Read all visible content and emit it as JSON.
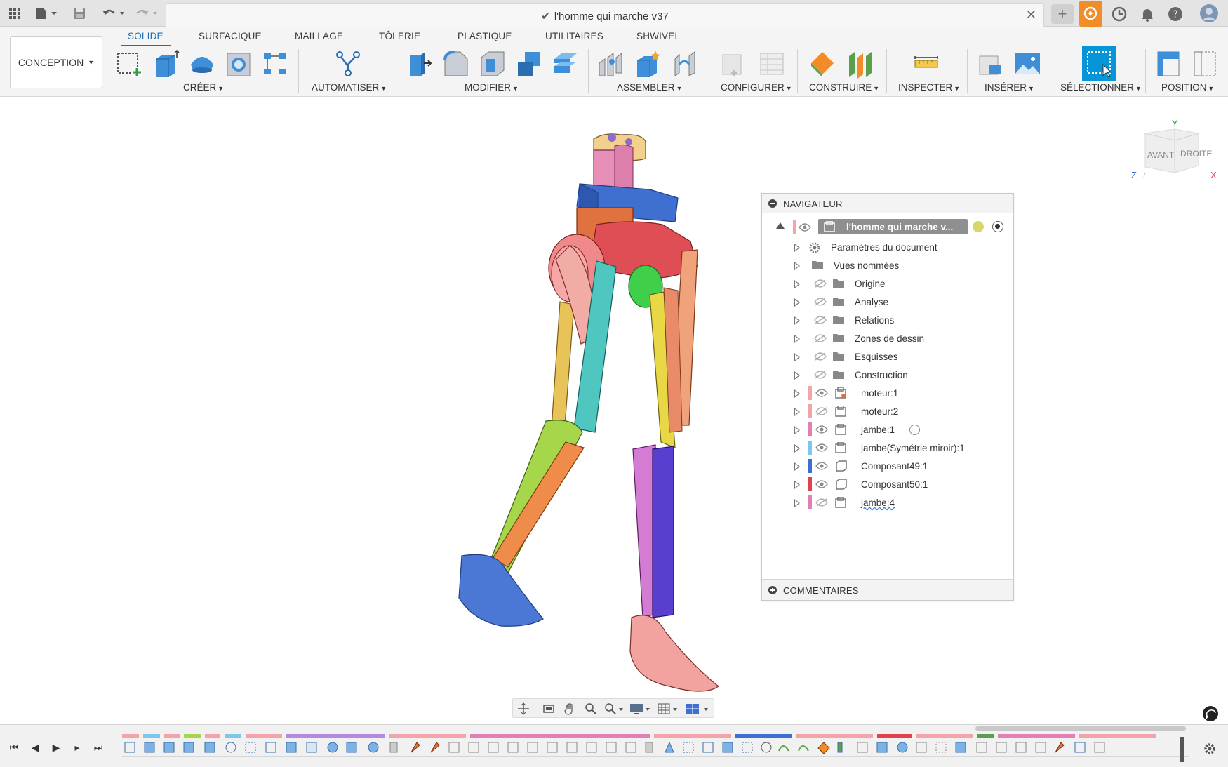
{
  "app": {
    "document_title": "l'homme qui marche v37"
  },
  "tabs": [
    {
      "label": "SOLIDE",
      "active": true
    },
    {
      "label": "SURFACIQUE"
    },
    {
      "label": "MAILLAGE"
    },
    {
      "label": "TÔLERIE"
    },
    {
      "label": "PLASTIQUE"
    },
    {
      "label": "UTILITAIRES"
    },
    {
      "label": "SHWIVEL"
    }
  ],
  "toolbar": {
    "workspace": "CONCEPTION",
    "groups": [
      "CRÉER",
      "AUTOMATISER",
      "MODIFIER",
      "ASSEMBLER",
      "CONFIGURER",
      "CONSTRUIRE",
      "INSPECTER",
      "INSÉRER",
      "SÉLECTIONNER",
      "POSITION"
    ]
  },
  "viewcube": {
    "face_front": "AVANT",
    "face_right": "DROITE",
    "axis_x": "X",
    "axis_y": "Y",
    "axis_z": "Z"
  },
  "navigator": {
    "title": "NAVIGATEUR",
    "root": "l'homme qui marche v...",
    "items": [
      {
        "label": "Paramètres du document",
        "icon": "gear-icon"
      },
      {
        "label": "Vues nommées",
        "icon": "folder-icon"
      },
      {
        "label": "Origine",
        "icon": "folder-icon",
        "visible": false
      },
      {
        "label": "Analyse",
        "icon": "folder-icon",
        "visible": false
      },
      {
        "label": "Relations",
        "icon": "folder-icon",
        "visible": false
      },
      {
        "label": "Zones de dessin",
        "icon": "folder-icon",
        "visible": false
      },
      {
        "label": "Esquisses",
        "icon": "folder-icon",
        "visible": false
      },
      {
        "label": "Construction",
        "icon": "folder-icon",
        "visible": false
      },
      {
        "label": "moteur:1",
        "icon": "component-icon",
        "visible": true,
        "color": "#f4a3a8"
      },
      {
        "label": "moteur:2",
        "icon": "component-icon",
        "visible": false,
        "color": "#f4a3a8"
      },
      {
        "label": "jambe:1",
        "icon": "component-icon",
        "visible": true,
        "color": "#e47fb4"
      },
      {
        "label": "jambe(Symétrie miroir):1",
        "icon": "component-icon",
        "visible": true,
        "color": "#7cc8ec"
      },
      {
        "label": "Composant49:1",
        "icon": "body-icon",
        "visible": true,
        "color": "#3b6fd6"
      },
      {
        "label": "Composant50:1",
        "icon": "body-icon",
        "visible": true,
        "color": "#e0434f"
      },
      {
        "label": "jambe:4",
        "icon": "component-icon",
        "visible": false,
        "color": "#e47fb4"
      }
    ],
    "comments": "COMMENTAIRES"
  },
  "colors": {
    "accent": "#1f6fb2",
    "highlight": "#0696d7",
    "orange_ext": "#f28c28"
  }
}
